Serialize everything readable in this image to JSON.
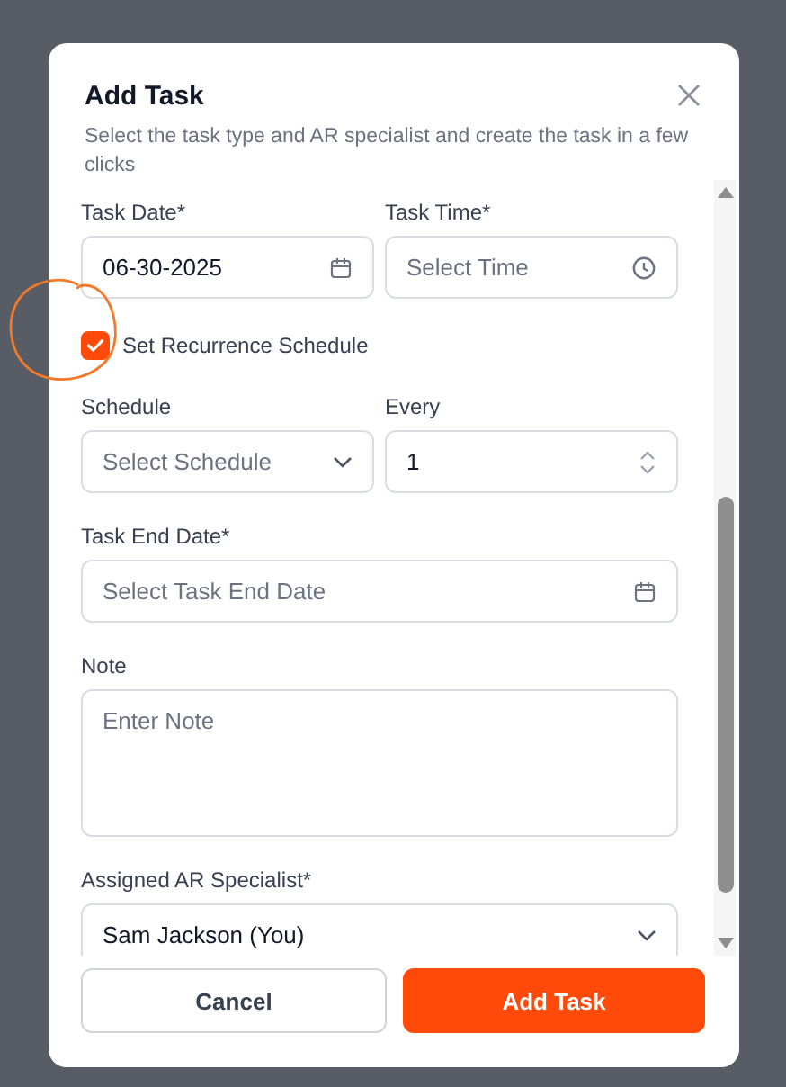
{
  "dialog": {
    "title": "Add Task",
    "subtitle": "Select the task type and AR specialist and create the task in a few clicks"
  },
  "rows": [
    [
      {
        "kind": "date",
        "label": "Task Date*",
        "value": "06-30-2025"
      },
      {
        "kind": "time",
        "label": "Task Time*",
        "placeholder": "Select Time"
      }
    ],
    [
      {
        "kind": "checkbox",
        "label": "Set Recurrence Schedule",
        "checked": true
      }
    ],
    [
      {
        "kind": "select",
        "label": "Schedule",
        "placeholder": "Select Schedule"
      },
      {
        "kind": "number",
        "label": "Every",
        "value": "1"
      }
    ],
    [
      {
        "kind": "date",
        "label": "Task End Date*",
        "placeholder": "Select Task End Date"
      }
    ],
    [
      {
        "kind": "textarea",
        "label": "Note",
        "placeholder": "Enter Note"
      }
    ],
    [
      {
        "kind": "select",
        "label": "Assigned AR Specialist*",
        "value": "Sam Jackson (You)"
      }
    ]
  ],
  "buttons": [
    {
      "kind": "secondary",
      "label": "Cancel"
    },
    {
      "kind": "primary",
      "label": "Add Task"
    }
  ]
}
